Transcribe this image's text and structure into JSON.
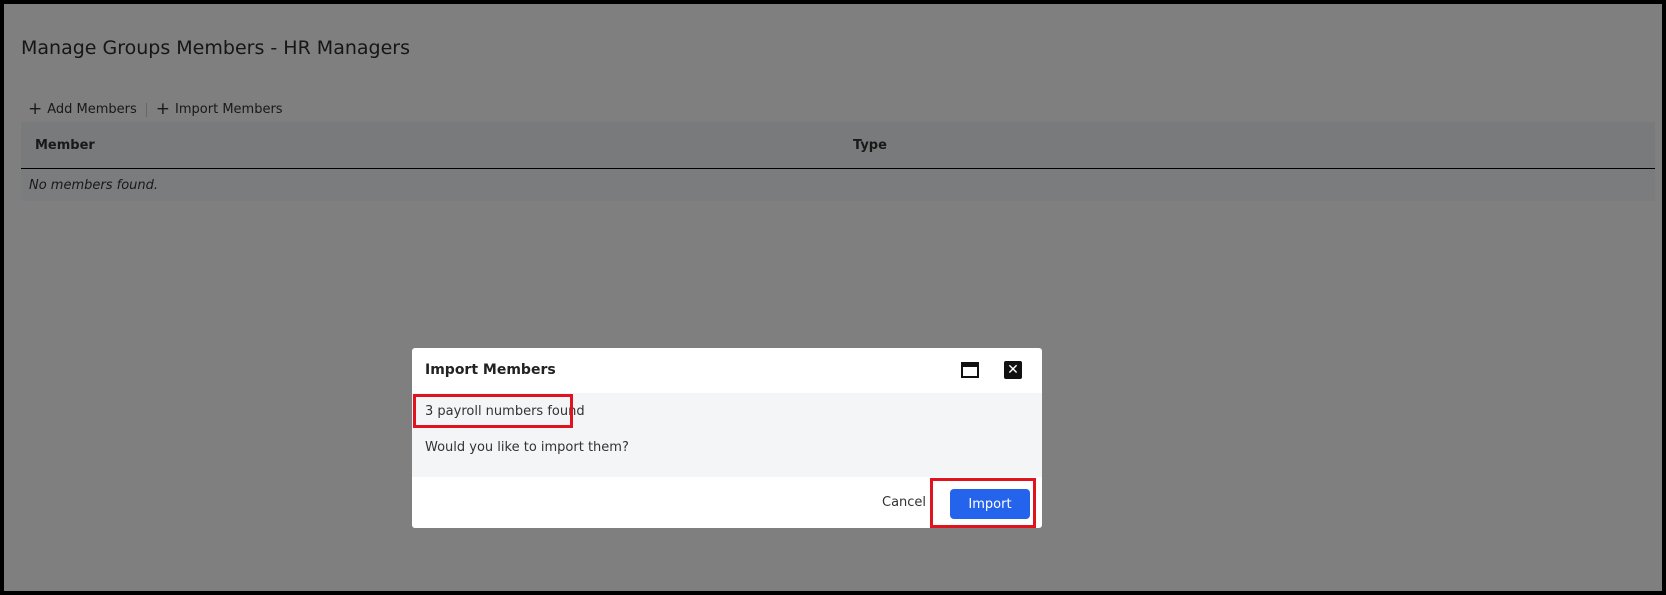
{
  "page": {
    "title": "Manage Groups Members - HR Managers"
  },
  "toolbar": {
    "add_members_label": "Add Members",
    "import_members_label": "Import Members"
  },
  "table": {
    "columns": [
      "Member",
      "Type"
    ],
    "empty_message": "No members found."
  },
  "dialog": {
    "title": "Import Members",
    "found_message": "3 payroll numbers found",
    "question": "Would you like to import them?",
    "cancel_label": "Cancel",
    "import_label": "Import"
  },
  "colors": {
    "primary_button": "#2463eb",
    "highlight": "#e0141e",
    "overlay": "rgba(0,0,0,0.5)"
  }
}
